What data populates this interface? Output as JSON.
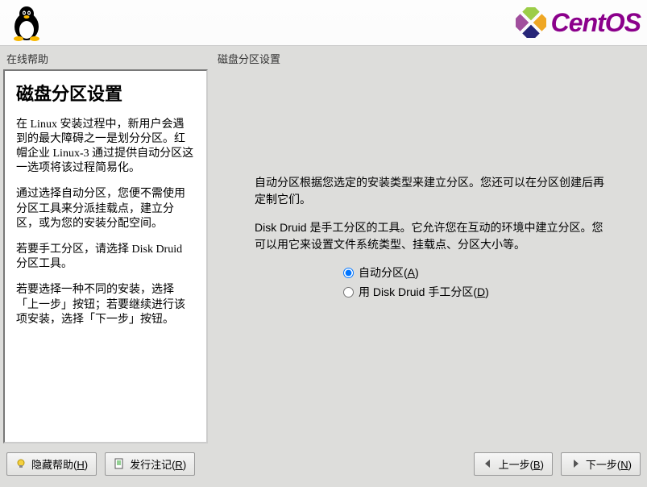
{
  "header": {
    "brand": "CentOS"
  },
  "help": {
    "label": "在线帮助",
    "title": "磁盘分区设置",
    "paragraphs": [
      "在 Linux 安装过程中，新用户会遇到的最大障碍之一是划分分区。红帽企业 Linux-3 通过提供自动分区这一选项将该过程简易化。",
      "通过选择自动分区，您便不需使用分区工具来分派挂载点，建立分区，或为您的安装分配空间。",
      "若要手工分区，请选择 Disk Druid 分区工具。",
      "若要选择一种不同的安装，选择「上一步」按钮；若要继续进行该项安装，选择「下一步」按钮。"
    ]
  },
  "main": {
    "label": "磁盘分区设置",
    "info1": "自动分区根据您选定的安装类型来建立分区。您还可以在分区创建后再定制它们。",
    "info2": "Disk Druid 是手工分区的工具。它允许您在互动的环境中建立分区。您可以用它来设置文件系统类型、挂载点、分区大小等。",
    "radios": {
      "auto_label_prefix": "自动分区(",
      "auto_mnemonic": "A",
      "auto_suffix": ")",
      "manual_label_prefix": "用 Disk Druid 手工分区(",
      "manual_mnemonic": "D",
      "manual_suffix": ")"
    }
  },
  "footer": {
    "hide_help_prefix": "隐藏帮助(",
    "hide_help_mnemonic": "H",
    "hide_help_suffix": ")",
    "release_notes_prefix": "发行注记(",
    "release_notes_mnemonic": "R",
    "release_notes_suffix": ")",
    "back_prefix": "上一步(",
    "back_mnemonic": "B",
    "back_suffix": ")",
    "next_prefix": "下一步(",
    "next_mnemonic": "N",
    "next_suffix": ")"
  }
}
